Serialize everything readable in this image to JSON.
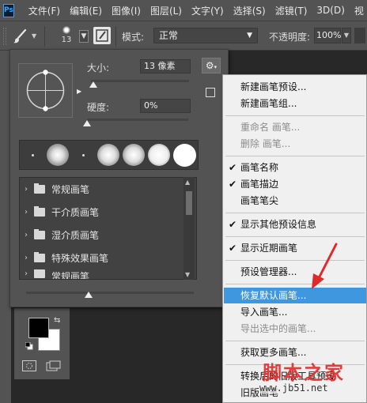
{
  "app": {
    "logo_text": "Ps",
    "accent_color": "#31a8ff"
  },
  "menubar": {
    "items": [
      "文件(F)",
      "编辑(E)",
      "图像(I)",
      "图层(L)",
      "文字(Y)",
      "选择(S)",
      "滤镜(T)",
      "3D(D)",
      "视"
    ]
  },
  "options": {
    "brush_size_preview": "13",
    "mode_label": "模式:",
    "mode_value": "正常",
    "opacity_label": "不透明度:",
    "opacity_value": "100%"
  },
  "picker": {
    "size_label": "大小:",
    "size_value": "13 像素",
    "hardness_label": "硬度:",
    "hardness_value": "0%",
    "presets": [
      {
        "label": "常规画笔"
      },
      {
        "label": "干介质画笔"
      },
      {
        "label": "湿介质画笔"
      },
      {
        "label": "特殊效果画笔"
      },
      {
        "label": "常规画笔"
      }
    ]
  },
  "flyout": {
    "highlight_color": "#3f97e0",
    "items": [
      {
        "label": "新建画笔预设...",
        "checked": false,
        "disabled": false
      },
      {
        "label": "新建画笔组...",
        "checked": false,
        "disabled": false
      },
      {
        "label": "重命名 画笔...",
        "checked": false,
        "disabled": true
      },
      {
        "label": "删除 画笔...",
        "checked": false,
        "disabled": true
      },
      {
        "label": "画笔名称",
        "checked": true,
        "disabled": false
      },
      {
        "label": "画笔描边",
        "checked": true,
        "disabled": false
      },
      {
        "label": "画笔笔尖",
        "checked": false,
        "disabled": false
      },
      {
        "label": "显示其他预设信息",
        "checked": true,
        "disabled": false
      },
      {
        "label": "显示近期画笔",
        "checked": true,
        "disabled": false
      },
      {
        "label": "预设管理器...",
        "checked": false,
        "disabled": false
      },
      {
        "label": "恢复默认画笔...",
        "checked": false,
        "disabled": false,
        "highlighted": true
      },
      {
        "label": "导入画笔...",
        "checked": false,
        "disabled": false
      },
      {
        "label": "导出选中的画笔...",
        "checked": false,
        "disabled": true
      },
      {
        "label": "获取更多画笔...",
        "checked": false,
        "disabled": false
      },
      {
        "label": "转换后的旧版工具预设",
        "checked": false,
        "disabled": false
      },
      {
        "label": "旧版画笔",
        "checked": false,
        "disabled": false
      }
    ]
  },
  "watermark": {
    "text": "脚本之家",
    "url": "www.jb51.net",
    "color": "#e0312f"
  }
}
